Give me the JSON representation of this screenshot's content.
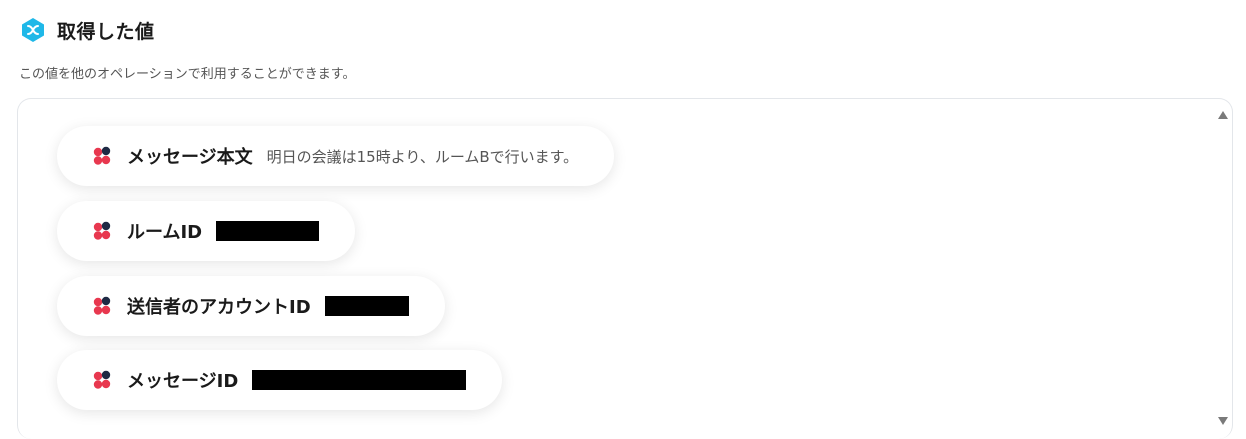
{
  "header": {
    "title": "取得した値",
    "description": "この値を他のオペレーションで利用することができます。"
  },
  "colors": {
    "badge": "#1fb8e8",
    "icon_dark": "#1f2a44",
    "icon_red": "#e8384f"
  },
  "fields": [
    {
      "label": "メッセージ本文",
      "value": "明日の会議は15時より、ルームBで行います。",
      "redacted": false
    },
    {
      "label": "ルームID",
      "value": "",
      "redacted": true
    },
    {
      "label": "送信者のアカウントID",
      "value": "",
      "redacted": true
    },
    {
      "label": "メッセージID",
      "value": "",
      "redacted": true
    }
  ]
}
